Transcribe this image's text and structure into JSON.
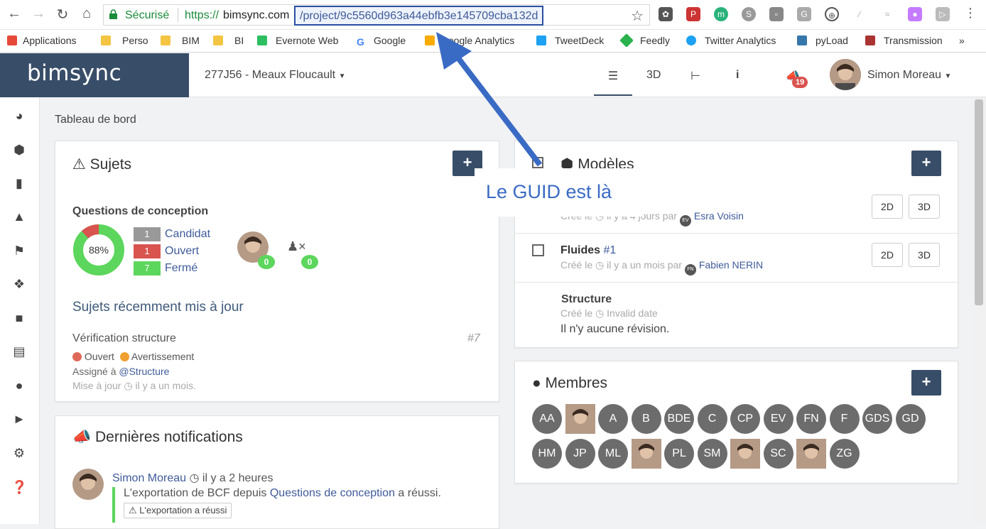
{
  "browser": {
    "secure_label": "Sécurisé",
    "url_scheme": "https://",
    "url_host": "bimsync.com",
    "url_path": "/project/9c5560d963a44ebfb3e145709cba132d",
    "extensions": [
      "evernote-icon",
      "pdf-icon",
      "m-icon",
      "skype-icon",
      "note-icon",
      "g-icon",
      "chrome-icon",
      "brush-icon",
      "wave-icon",
      "paint-icon",
      "cast-icon"
    ]
  },
  "bookmarks": [
    {
      "label": "Applications",
      "icon": "apps-grid-icon",
      "color": "#e6493a"
    },
    {
      "label": "Perso",
      "icon": "folder-icon",
      "color": "#f4c542"
    },
    {
      "label": "BIM",
      "icon": "folder-icon",
      "color": "#f4c542"
    },
    {
      "label": "BI",
      "icon": "folder-icon",
      "color": "#f4c542"
    },
    {
      "label": "Evernote Web",
      "icon": "evernote-icon",
      "color": "#2dbe60"
    },
    {
      "label": "Google",
      "icon": "google-icon",
      "color": "#4285f4"
    },
    {
      "label": "Google Analytics",
      "icon": "analytics-icon",
      "color": "#f9ab00"
    },
    {
      "label": "TweetDeck",
      "icon": "tweetdeck-icon",
      "color": "#1da1f2"
    },
    {
      "label": "Feedly",
      "icon": "feedly-icon",
      "color": "#2bb24c"
    },
    {
      "label": "Twitter Analytics",
      "icon": "twitter-icon",
      "color": "#1da1f2"
    },
    {
      "label": "pyLoad",
      "icon": "python-icon",
      "color": "#3776ab"
    },
    {
      "label": "Transmission",
      "icon": "transmission-icon",
      "color": "#a33"
    }
  ],
  "bookmarks_more": "»",
  "app": {
    "logo": "bimsync",
    "project": "277J56 - Meaux Floucault",
    "nav_3d": "3D",
    "nav_info": "i",
    "notif_count": "19",
    "user_name": "Simon Moreau",
    "breadcrumb": "Tableau de bord"
  },
  "sujets": {
    "title": "Sujets",
    "add": "+",
    "group_title": "Questions de conception",
    "percent": "88%",
    "stats": [
      {
        "count": "1",
        "label": "Candidat",
        "color": "#999999"
      },
      {
        "count": "1",
        "label": "Ouvert",
        "color": "#d9534f"
      },
      {
        "count": "7",
        "label": "Fermé",
        "color": "#5cd65c"
      }
    ],
    "assignee_count": "0",
    "unassigned_count": "0",
    "recent_title": "Sujets récemment mis à jour",
    "item_title": "Vérification structure",
    "item_number": "#7",
    "status_open": "Ouvert",
    "status_warn": "Avertissement",
    "assigned_prefix": "Assigné à ",
    "assigned_to": "@Structure",
    "updated": "Mise à jour",
    "updated_when": "il y a un mois."
  },
  "notifications": {
    "title": "Dernières notifications",
    "author": "Simon Moreau",
    "when": "il y a 2 heures",
    "message_prefix": "L'exportation de BCF depuis ",
    "message_link": "Questions de conception",
    "message_suffix": " a réussi.",
    "badge": "L'exportation a réussi"
  },
  "modeles": {
    "title": "Modèles",
    "add": "+",
    "row1_trunc": "4",
    "row1_meta_prefix": "Créé le",
    "row1_meta_when": "il y a 4 jours par",
    "row1_author_initials": "EV",
    "row1_author": "Esra Voisin",
    "row2_name": "Fluides",
    "row2_rev": "#1",
    "row2_meta_prefix": "Créé le",
    "row2_meta_when": "il y a un mois par",
    "row2_author_initials": "FN",
    "row2_author": "Fabien NERIN",
    "row3_name": "Structure",
    "row3_meta_prefix": "Créé le",
    "row3_meta_when": "Invalid date",
    "row3_note": "Il n'y aucune révision.",
    "btn_2d": "2D",
    "btn_3d": "3D"
  },
  "membres": {
    "title": "Membres",
    "add": "+",
    "members": [
      "AA",
      "",
      "A",
      "B",
      "BDE",
      "C",
      "CP",
      "EV",
      "FN",
      "F",
      "GDS",
      "GD",
      "HM",
      "JP",
      "ML",
      "",
      "PL",
      "SM",
      "",
      "SC",
      "",
      "ZG"
    ]
  },
  "annotation": {
    "text": "Le GUID est là",
    "color": "#3a6bc4"
  }
}
